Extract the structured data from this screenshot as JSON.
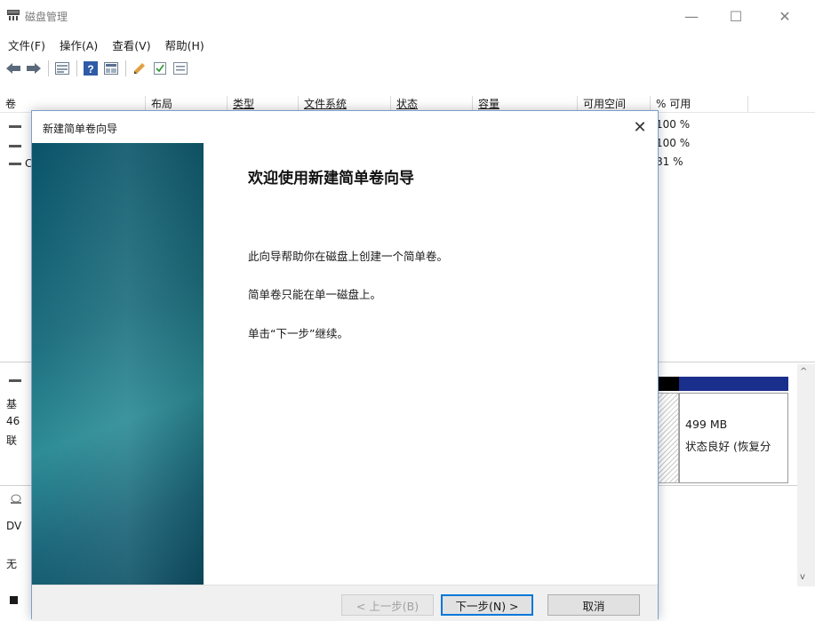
{
  "window": {
    "title": "磁盘管理"
  },
  "menu": [
    {
      "label": "文件(F)"
    },
    {
      "label": "操作(A)"
    },
    {
      "label": "查看(V)"
    },
    {
      "label": "帮助(H)"
    }
  ],
  "toolbar": {
    "icons": [
      "back-arrow-icon",
      "forward-arrow-icon",
      "volume-list-icon",
      "help-icon",
      "disk-view-icon",
      "pencil-icon",
      "checkbox-icon",
      "properties-icon"
    ]
  },
  "volume_list": {
    "columns": [
      "卷",
      "布局",
      "类型",
      "文件系统",
      "状态",
      "容量",
      "可用空间",
      "% 可用"
    ],
    "pct_values": [
      "100 %",
      "100 %",
      "81 %"
    ],
    "row_fragment": "C"
  },
  "disk_area": {
    "fragments": [
      "基",
      "46",
      "联",
      "DV",
      "无"
    ],
    "partition": {
      "size": "499 MB",
      "status": "状态良好 (恢复分"
    }
  },
  "wizard": {
    "title": "新建简单卷向导",
    "heading": "欢迎使用新建简单卷向导",
    "paragraphs": [
      "此向导帮助你在磁盘上创建一个简单卷。",
      "简单卷只能在单一磁盘上。",
      "单击“下一步”继续。"
    ],
    "buttons": {
      "back": "< 上一步(B)",
      "next": "下一步(N) >",
      "cancel": "取消"
    }
  },
  "colors": {
    "banner_dark": "#0a5368",
    "banner_light": "#2c8c96",
    "partition_header": "#1a2f8c",
    "accent": "#0078d7"
  }
}
